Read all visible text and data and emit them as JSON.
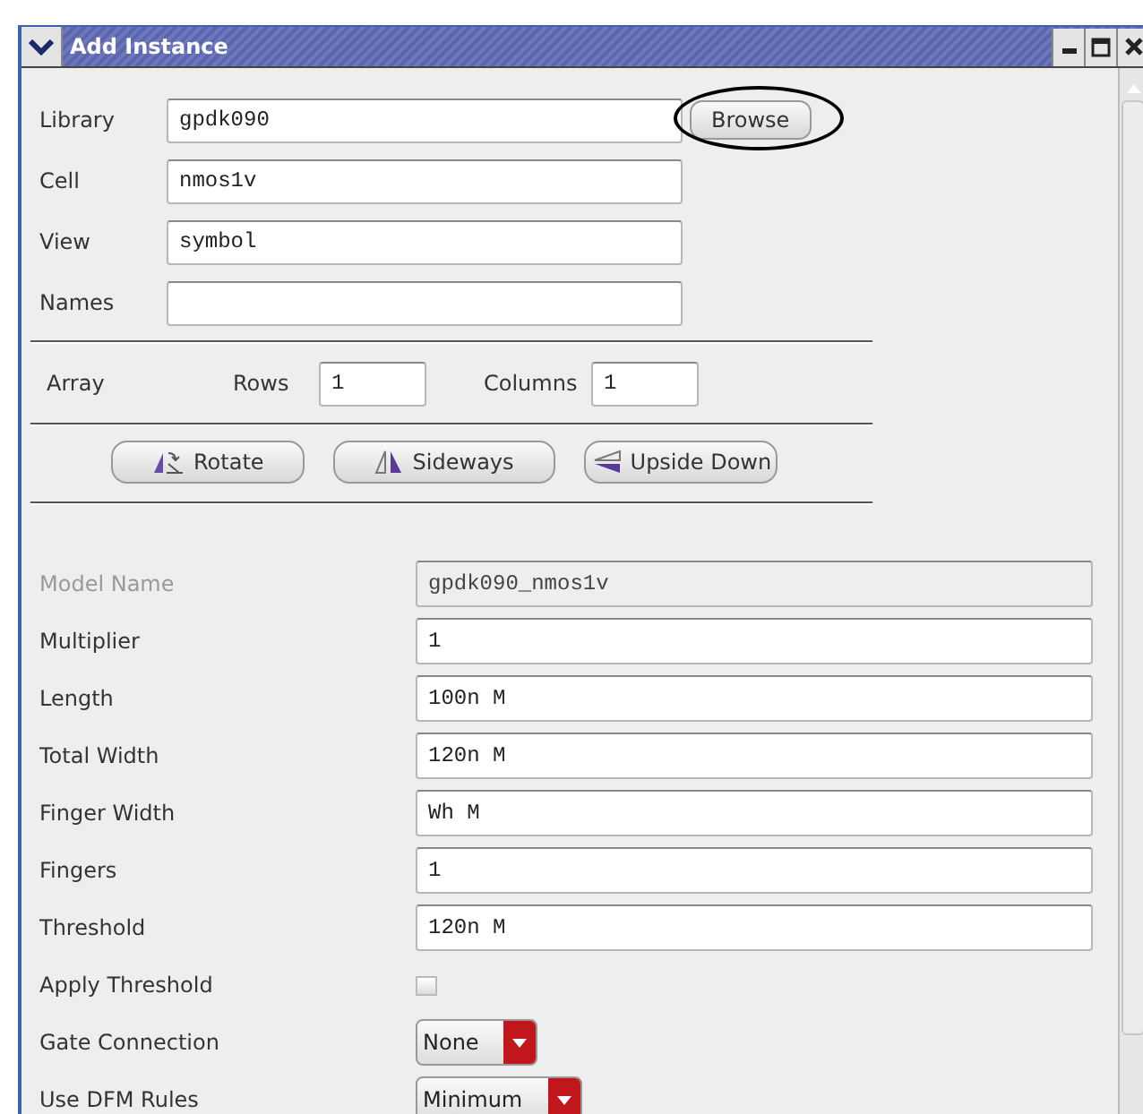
{
  "window": {
    "title": "Add Instance"
  },
  "top_fields": [
    {
      "label": "Library",
      "value": "gpdk090"
    },
    {
      "label": "Cell",
      "value": "nmos1v"
    },
    {
      "label": "View",
      "value": "symbol"
    },
    {
      "label": "Names"
    }
  ],
  "browse_button": {
    "label": "Browse",
    "circled": true
  },
  "array": {
    "label": "Array",
    "rows_label": "Rows",
    "rows": "1",
    "columns_label": "Columns",
    "columns": "1"
  },
  "transform_buttons": [
    {
      "label": "Rotate",
      "kind": "rotate"
    },
    {
      "label": "Sideways",
      "kind": "sideways"
    },
    {
      "label": "Upside Down",
      "kind": "upside"
    }
  ],
  "params": [
    {
      "label": "Model Name",
      "kind": "text",
      "value": "gpdk090_nmos1v",
      "disabled": true
    },
    {
      "label": "Multiplier",
      "kind": "text",
      "value": "1",
      "disabled": false
    },
    {
      "label": "Length",
      "kind": "text",
      "value": "100n M",
      "disabled": false
    },
    {
      "label": "Total Width",
      "kind": "text",
      "value": "120n M",
      "disabled": false
    },
    {
      "label": "Finger Width",
      "kind": "text",
      "value": "Wh M",
      "disabled": false
    },
    {
      "label": "Fingers",
      "kind": "text",
      "value": "1",
      "disabled": false
    },
    {
      "label": "Threshold",
      "kind": "text",
      "value": "120n M",
      "disabled": false
    },
    {
      "label": "Apply Threshold",
      "kind": "checkbox",
      "checked": false,
      "disabled": false
    },
    {
      "label": "Gate Connection",
      "kind": "select",
      "value": "None",
      "disabled": false
    },
    {
      "label": "Use DFM Rules",
      "kind": "select",
      "value": "Minimum",
      "disabled": false
    }
  ]
}
